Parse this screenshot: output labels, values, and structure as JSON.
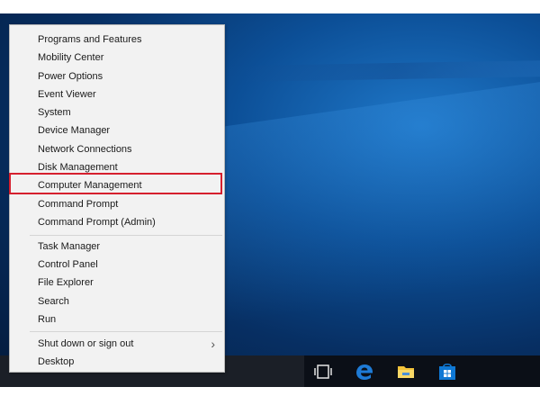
{
  "menu": {
    "groups": [
      [
        "Programs and Features",
        "Mobility Center",
        "Power Options",
        "Event Viewer",
        "System",
        "Device Manager",
        "Network Connections",
        "Disk Management",
        "Computer Management",
        "Command Prompt",
        "Command Prompt (Admin)"
      ],
      [
        "Task Manager",
        "Control Panel",
        "File Explorer",
        "Search",
        "Run"
      ],
      [
        "Shut down or sign out",
        "Desktop"
      ]
    ],
    "highlighted_item": "Computer Management",
    "submenu_indicator": "›"
  },
  "taskbar": {
    "icons": [
      "task-view-icon",
      "edge-icon",
      "file-explorer-icon",
      "store-icon"
    ]
  },
  "colors": {
    "highlight_border": "#d6202e",
    "menu_background": "#f2f2f2",
    "edge_blue": "#1e7bd6",
    "store_blue": "#0f78d4",
    "folder_yellow": "#f3c33a"
  }
}
